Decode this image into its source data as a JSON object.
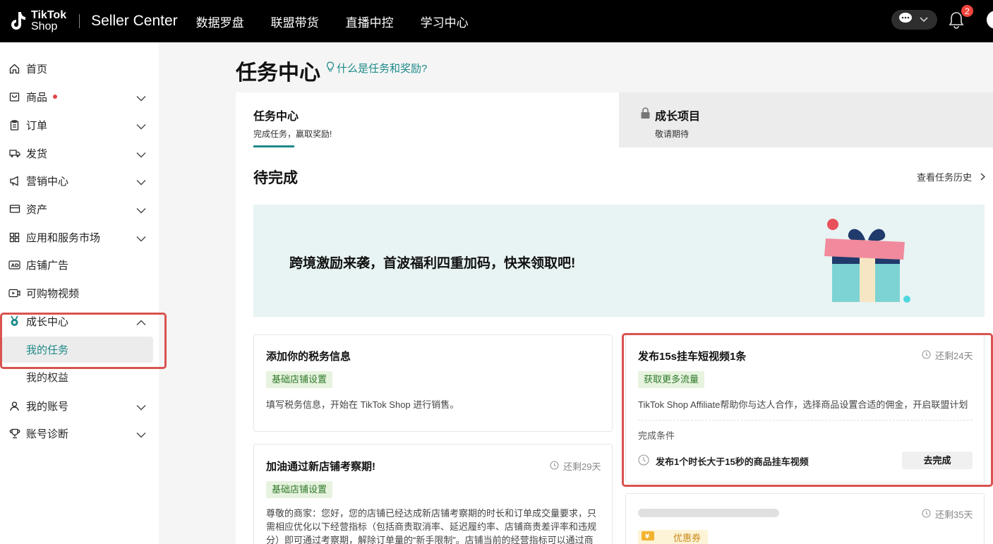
{
  "header": {
    "logo_line1": "TikTok",
    "logo_line2": "Shop",
    "app_title": "Seller Center",
    "nav": [
      "数据罗盘",
      "联盟带货",
      "直播中控",
      "学习中心"
    ],
    "notification_count": "2"
  },
  "sidebar": {
    "items": [
      {
        "label": "首页",
        "icon": "home-icon"
      },
      {
        "label": "商品",
        "icon": "product-icon",
        "badge_dot": true
      },
      {
        "label": "订单",
        "icon": "clipboard-icon"
      },
      {
        "label": "发货",
        "icon": "truck-icon"
      },
      {
        "label": "营销中心",
        "icon": "megaphone-icon"
      },
      {
        "label": "资产",
        "icon": "wallet-icon"
      },
      {
        "label": "应用和服务市场",
        "icon": "apps-icon"
      },
      {
        "label": "店铺广告",
        "icon": "ad-icon"
      },
      {
        "label": "可购物视频",
        "icon": "video-icon"
      },
      {
        "label": "成长中心",
        "icon": "medal-icon"
      },
      {
        "label": "我的账号",
        "icon": "user-icon"
      },
      {
        "label": "账号诊断",
        "icon": "trophy-icon"
      }
    ],
    "subitems": {
      "my_tasks": "我的任务",
      "my_benefits": "我的权益"
    }
  },
  "main": {
    "title": "任务中心",
    "help_link": "什么是任务和奖励?",
    "tabs": [
      {
        "title": "任务中心",
        "subtitle": "完成任务，赢取奖励!"
      },
      {
        "title": "成长项目",
        "subtitle": "敬请期待"
      }
    ],
    "section_title": "待完成",
    "history_link": "查看任务历史",
    "banner_text": "跨境激励来袭，首波福利四重加码，快来领取吧!",
    "cards": {
      "tax": {
        "title": "添加你的税务信息",
        "tag": "基础店铺设置",
        "desc": "填写税务信息，开始在 TikTok Shop 进行销售。"
      },
      "video": {
        "title": "发布15s挂车短视频1条",
        "remaining": "还剩24天",
        "tag": "获取更多流量",
        "desc": "TikTok Shop Affiliate帮助你与达人合作，选择商品设置合适的佣金，开启联盟计划",
        "condition_label": "完成条件",
        "condition": "发布1个时长大于15秒的商品挂车视频",
        "button": "去完成"
      },
      "review": {
        "title": "加油通过新店铺考察期!",
        "remaining": "还剩29天",
        "tag": "基础店铺设置",
        "desc": "尊敬的商家：您好，您的店铺已经达成新店铺考察期的时长和订单成交量要求，只需相应优化以下经营指标（包括商责取消率、延迟履约率、店铺商责差评率和违规分）即可通过考察期，解除订单量的“新手限制”。店铺当前的经营指标可以通过商家后台"
      },
      "coupon": {
        "remaining": "还剩35天",
        "tag": "优惠券"
      }
    }
  },
  "colors": {
    "accent": "#1f8a8a",
    "highlight": "#d9534f",
    "tag_bg": "#e7f3df",
    "tag_text": "#2f7a2a"
  }
}
